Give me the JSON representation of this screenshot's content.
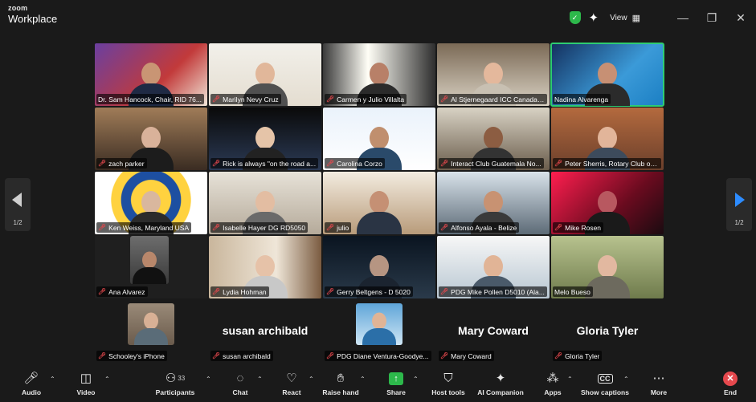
{
  "app": {
    "brand_small": "zoom",
    "brand_large": "Workplace",
    "view_label": "View"
  },
  "icons": {
    "security": "shield-check-icon",
    "ai": "sparkle-icon",
    "view": "grid-icon",
    "minimize": "minimize-icon",
    "restore": "restore-icon",
    "close": "close-icon"
  },
  "pages": {
    "left": "1/2",
    "right": "1/2"
  },
  "tiles": [
    {
      "name": "Dr. Sam Hancock, Chair, RID 76...",
      "muted": false
    },
    {
      "name": "Marilyn Nevy Cruz",
      "muted": true
    },
    {
      "name": "Carmen y Julio Villalta",
      "muted": true
    },
    {
      "name": "Al Stjernegaard ICC Canada ...",
      "muted": true
    },
    {
      "name": "Nadina Alvarenga",
      "muted": false
    },
    {
      "name": "zach parker",
      "muted": true
    },
    {
      "name": "Rick is always \"on the road a...",
      "muted": true
    },
    {
      "name": "Carolina Corzo",
      "muted": true
    },
    {
      "name": "Interact Club Guatemala No...",
      "muted": true
    },
    {
      "name": "Peter Sherris, Rotary Club of ...",
      "muted": true
    },
    {
      "name": "Ken Weiss, Maryland USA",
      "muted": true
    },
    {
      "name": "Isabelle Hayer DG RD5050",
      "muted": true
    },
    {
      "name": "julio",
      "muted": true
    },
    {
      "name": "Alfonso Ayala - Belize",
      "muted": true
    },
    {
      "name": "Mike Rosen",
      "muted": true
    },
    {
      "name": "Ana Alvarez",
      "muted": true
    },
    {
      "name": "Lydia Hohman",
      "muted": true
    },
    {
      "name": "Gerry Beltgens - D 5020",
      "muted": true
    },
    {
      "name": "PDG Mike Pollen D5010 (Ala...",
      "muted": true
    },
    {
      "name": "Melo Bueso",
      "muted": false
    },
    {
      "name": "Schooley's iPhone",
      "muted": true
    },
    {
      "name": "susan archibald",
      "muted": true,
      "big": "susan archibald"
    },
    {
      "name": "PDG Diane Ventura-Goodye...",
      "muted": true
    },
    {
      "name": "Mary Coward",
      "muted": true,
      "big": "Mary Coward"
    },
    {
      "name": "Gloria Tyler",
      "muted": true,
      "big": "Gloria Tyler"
    }
  ],
  "toolbar": {
    "audio": "Audio",
    "video": "Video",
    "participants": "Participants",
    "participants_count": "33",
    "chat": "Chat",
    "react": "React",
    "raise_hand": "Raise hand",
    "share": "Share",
    "host_tools": "Host tools",
    "ai_companion": "AI Companion",
    "apps": "Apps",
    "captions": "Show captions",
    "captions_badge": "CC",
    "more": "More",
    "end": "End"
  }
}
